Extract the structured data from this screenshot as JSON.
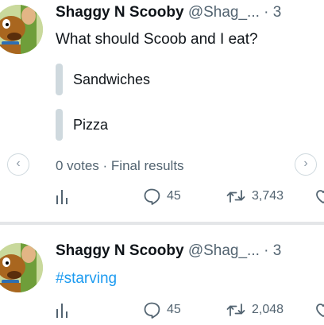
{
  "tweets": [
    {
      "name": "Shaggy N Scooby",
      "handle": "@Shag_...",
      "separator": "· 3",
      "text": "What should Scoob and I eat?",
      "poll": {
        "options": [
          {
            "label": "Sandwiches",
            "share": 0
          },
          {
            "label": "Pizza",
            "share": 0
          }
        ],
        "meta": "0 votes · Final results"
      },
      "actions": {
        "analytics_icon": "bar-chart-icon",
        "replies": "45",
        "retweets": "3,743",
        "like_icon": "heart-icon"
      },
      "nav": {
        "prev_icon": "‹",
        "next_icon": "›"
      }
    },
    {
      "name": "Shaggy N Scooby",
      "handle": "@Shag_...",
      "separator": "· 3",
      "text": "#starving",
      "actions": {
        "analytics_icon": "bar-chart-icon",
        "replies": "45",
        "retweets": "2,048",
        "like_icon": "heart-icon"
      }
    }
  ],
  "colors": {
    "text": "#0f1419",
    "secondary": "#536471",
    "hashtag": "#1d9bf0",
    "poll_bar": "#cfd9de",
    "divider": "#e4e6e8"
  }
}
